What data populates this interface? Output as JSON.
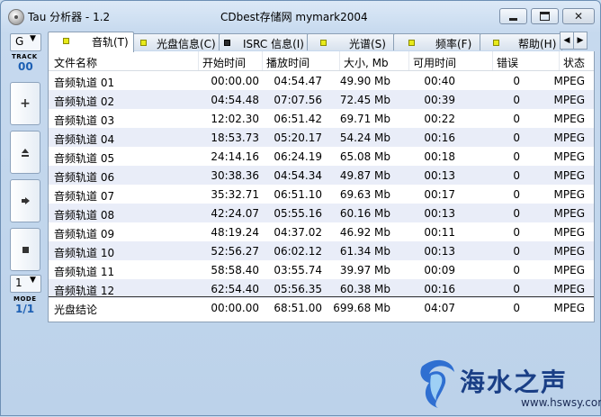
{
  "window": {
    "title_left": "Tau 分析器 - 1.2",
    "title_center": "CDbest存储网 mymark2004"
  },
  "left_panel": {
    "drive_value": "G",
    "track_label": "TRACK",
    "track_value": "00",
    "mode_value": "1",
    "mode_label": "MODE",
    "mode_display": "1/1"
  },
  "tabs": [
    {
      "label": "音轨(T)",
      "active": true
    },
    {
      "label": "光盘信息(C)"
    },
    {
      "label": "ISRC 信息(I)"
    },
    {
      "label": "光谱(S)"
    },
    {
      "label": "频率(F)"
    },
    {
      "label": "帮助(H)"
    }
  ],
  "table": {
    "headers": [
      "文件名称",
      "开始时间",
      "播放时间",
      "大小, Mb",
      "可用时间",
      "错误",
      "状态"
    ],
    "rows": [
      [
        "音频轨道 01",
        "00:00.00",
        "04:54.47",
        "49.90 Mb",
        "00:40",
        "0",
        "MPEG"
      ],
      [
        "音频轨道 02",
        "04:54.48",
        "07:07.56",
        "72.45 Mb",
        "00:39",
        "0",
        "MPEG"
      ],
      [
        "音频轨道 03",
        "12:02.30",
        "06:51.42",
        "69.71 Mb",
        "00:22",
        "0",
        "MPEG"
      ],
      [
        "音频轨道 04",
        "18:53.73",
        "05:20.17",
        "54.24 Mb",
        "00:16",
        "0",
        "MPEG"
      ],
      [
        "音频轨道 05",
        "24:14.16",
        "06:24.19",
        "65.08 Mb",
        "00:18",
        "0",
        "MPEG"
      ],
      [
        "音频轨道 06",
        "30:38.36",
        "04:54.34",
        "49.87 Mb",
        "00:13",
        "0",
        "MPEG"
      ],
      [
        "音频轨道 07",
        "35:32.71",
        "06:51.10",
        "69.63 Mb",
        "00:17",
        "0",
        "MPEG"
      ],
      [
        "音频轨道 08",
        "42:24.07",
        "05:55.16",
        "60.16 Mb",
        "00:13",
        "0",
        "MPEG"
      ],
      [
        "音频轨道 09",
        "48:19.24",
        "04:37.02",
        "46.92 Mb",
        "00:11",
        "0",
        "MPEG"
      ],
      [
        "音频轨道 10",
        "52:56.27",
        "06:02.12",
        "61.34 Mb",
        "00:13",
        "0",
        "MPEG"
      ],
      [
        "音频轨道 11",
        "58:58.40",
        "03:55.74",
        "39.97 Mb",
        "00:09",
        "0",
        "MPEG"
      ],
      [
        "音频轨道 12",
        "62:54.40",
        "05:56.35",
        "60.38 Mb",
        "00:16",
        "0",
        "MPEG"
      ]
    ],
    "summary": [
      "光盘结论",
      "00:00.00",
      "68:51.00",
      "699.68 Mb",
      "04:07",
      "0",
      "MPEG"
    ]
  },
  "watermark": {
    "text": "海水之声",
    "url": "www.hswsy.com"
  },
  "colors": {
    "accent_blue": "#1c5fb3",
    "row_alt": "#e9edf8",
    "tab_marker": "#e8ea1a"
  }
}
